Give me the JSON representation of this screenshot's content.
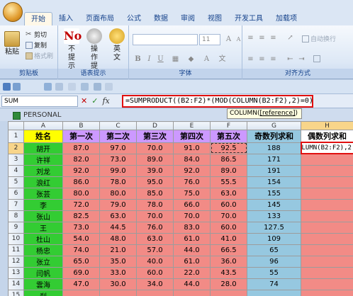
{
  "tabs": [
    "开始",
    "插入",
    "页面布局",
    "公式",
    "数据",
    "审阅",
    "视图",
    "开发工具",
    "加载项"
  ],
  "active_tab": "开始",
  "ribbon": {
    "clipboard": {
      "paste": "粘贴",
      "cut": "剪切",
      "copy": "复制",
      "format_painter": "格式刷",
      "label": "剪贴板"
    },
    "addin": {
      "no_prompt": "不提示",
      "operation_prompt": "操作提示",
      "english": "英文",
      "label": "语表提示"
    },
    "font": {
      "font_size": "11",
      "label": "字体"
    },
    "align": {
      "auto_wrap": "自动换行",
      "label": "对齐方式"
    }
  },
  "formula_bar": {
    "name_box": "SUM",
    "buttons": [
      "✕",
      "✓",
      "fx"
    ],
    "formula": "=SUMPRODUCT((B2:F2)*(MOD(COLUMN(B2:F2),2)=0))"
  },
  "tooltip": {
    "fn": "COLUMN(",
    "arg": "[reference]",
    "close": ")"
  },
  "workbook_title": "PERSONAL",
  "columns": [
    "A",
    "B",
    "C",
    "D",
    "E",
    "F",
    "G",
    "H"
  ],
  "headers": [
    "姓名",
    "第一次",
    "第二次",
    "第三次",
    "第四次",
    "第五次",
    "奇数列求和",
    "偶数列求和"
  ],
  "rows": [
    {
      "num": "2",
      "name": "胡开",
      "scores": [
        "87.0",
        "97.0",
        "70.0",
        "91.0",
        "92.5"
      ],
      "g": "188",
      "h": "LUMN(B2:F2),2"
    },
    {
      "num": "3",
      "name": "许祥",
      "scores": [
        "82.0",
        "73.0",
        "89.0",
        "84.0",
        "86.5"
      ],
      "g": "171",
      "h": ""
    },
    {
      "num": "4",
      "name": "刘龙",
      "scores": [
        "92.0",
        "99.0",
        "39.0",
        "92.0",
        "89.0"
      ],
      "g": "191",
      "h": ""
    },
    {
      "num": "5",
      "name": "浪红",
      "scores": [
        "86.0",
        "78.0",
        "95.0",
        "76.0",
        "55.5"
      ],
      "g": "154",
      "h": ""
    },
    {
      "num": "6",
      "name": "张芸",
      "scores": [
        "80.0",
        "80.0",
        "85.0",
        "75.0",
        "63.0"
      ],
      "g": "155",
      "h": ""
    },
    {
      "num": "7",
      "name": "李",
      "scores": [
        "72.0",
        "79.0",
        "78.0",
        "66.0",
        "60.0"
      ],
      "g": "145",
      "h": ""
    },
    {
      "num": "8",
      "name": "张山",
      "scores": [
        "82.5",
        "63.0",
        "70.0",
        "70.0",
        "70.0"
      ],
      "g": "133",
      "h": ""
    },
    {
      "num": "9",
      "name": "王",
      "scores": [
        "73.0",
        "44.5",
        "76.0",
        "83.0",
        "60.0"
      ],
      "g": "127.5",
      "h": ""
    },
    {
      "num": "10",
      "name": "杜山",
      "scores": [
        "54.0",
        "48.0",
        "63.0",
        "61.0",
        "41.0"
      ],
      "g": "109",
      "h": ""
    },
    {
      "num": "11",
      "name": "杨忠",
      "scores": [
        "74.0",
        "21.0",
        "57.0",
        "44.0",
        "66.5"
      ],
      "g": "65",
      "h": ""
    },
    {
      "num": "12",
      "name": "张立",
      "scores": [
        "65.0",
        "35.0",
        "40.0",
        "61.0",
        "36.0"
      ],
      "g": "96",
      "h": ""
    },
    {
      "num": "13",
      "name": "闫帆",
      "scores": [
        "69.0",
        "33.0",
        "60.0",
        "22.0",
        "43.5"
      ],
      "g": "55",
      "h": ""
    },
    {
      "num": "14",
      "name": "雲海",
      "scores": [
        "47.0",
        "30.0",
        "34.0",
        "44.0",
        "28.0"
      ],
      "g": "74",
      "h": ""
    },
    {
      "num": "15",
      "name": "刹",
      "scores": [
        "",
        "",
        "",
        "",
        ""
      ],
      "g": "",
      "h": ""
    }
  ],
  "colors": {
    "name_col": "#33cc33",
    "score_cells": "#f28b86",
    "purple_header": "#cc99ff",
    "teal_col": "#96c8e0",
    "formula_border": "#e01010"
  }
}
